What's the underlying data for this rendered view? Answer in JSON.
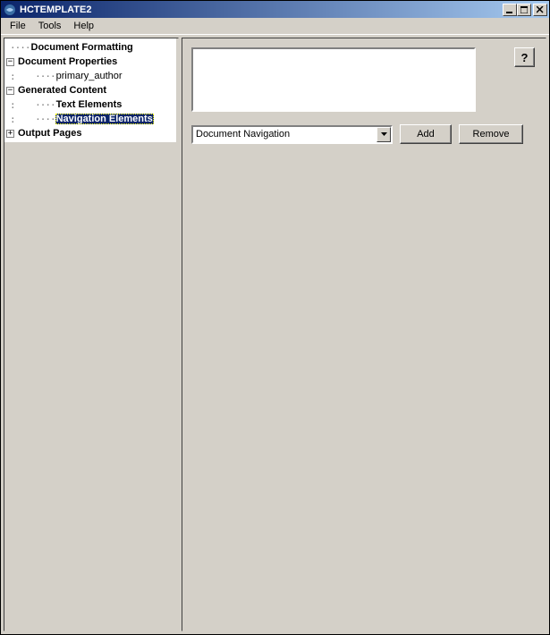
{
  "window": {
    "title": "HCTEMPLATE2"
  },
  "menu": {
    "file": "File",
    "tools": "Tools",
    "help": "Help"
  },
  "tree": {
    "doc_formatting": "Document Formatting",
    "doc_properties": "Document Properties",
    "primary_author": "primary_author",
    "generated_content": "Generated Content",
    "text_elements": "Text Elements",
    "navigation_elements": "Navigation Elements",
    "output_pages": "Output Pages"
  },
  "content": {
    "help_label": "?",
    "dropdown_value": "Document Navigation",
    "add_label": "Add",
    "remove_label": "Remove"
  }
}
